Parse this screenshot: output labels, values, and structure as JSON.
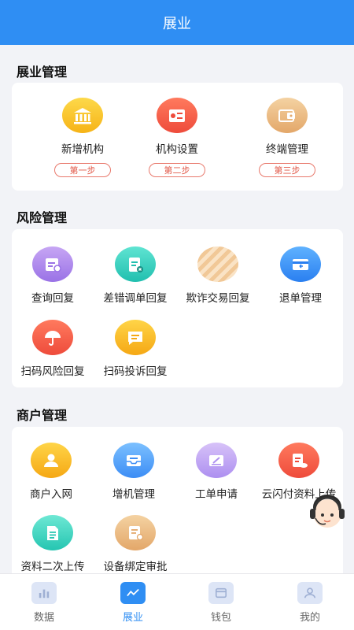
{
  "header": {
    "title": "展业"
  },
  "sections": [
    {
      "title": "展业管理",
      "items": [
        {
          "label": "新增机构",
          "step": "第一步",
          "icon": "bank-icon"
        },
        {
          "label": "机构设置",
          "step": "第二步",
          "icon": "settings-list-icon"
        },
        {
          "label": "终端管理",
          "step": "第三步",
          "icon": "pos-terminal-icon"
        }
      ]
    },
    {
      "title": "风险管理",
      "items": [
        {
          "label": "查询回复",
          "icon": "calendar-search-icon"
        },
        {
          "label": "差错调单回复",
          "icon": "document-error-icon"
        },
        {
          "label": "欺诈交易回复",
          "icon": "striped-ball-icon"
        },
        {
          "label": "退单管理",
          "icon": "card-return-icon"
        },
        {
          "label": "扫码风险回复",
          "icon": "umbrella-icon"
        },
        {
          "label": "扫码投诉回复",
          "icon": "message-icon"
        }
      ]
    },
    {
      "title": "商户管理",
      "items": [
        {
          "label": "商户入网",
          "icon": "merchant-user-icon"
        },
        {
          "label": "增机管理",
          "icon": "tray-icon"
        },
        {
          "label": "工单申请",
          "icon": "edit-form-icon"
        },
        {
          "label": "云闪付资料上传",
          "icon": "document-cloud-icon"
        },
        {
          "label": "资料二次上传",
          "icon": "document-lines-icon"
        },
        {
          "label": "设备绑定审批",
          "icon": "approval-doc-icon"
        }
      ]
    }
  ],
  "tabbar": {
    "items": [
      {
        "label": "数据",
        "icon": "bar-chart-icon",
        "active": false
      },
      {
        "label": "展业",
        "icon": "trend-line-icon",
        "active": true
      },
      {
        "label": "钱包",
        "icon": "wallet-icon",
        "active": false
      },
      {
        "label": "我的",
        "icon": "profile-icon",
        "active": false
      }
    ]
  },
  "colors": {
    "primary": "#2f8ef3",
    "step_red": "#e25b4b",
    "background": "#f2f3f7"
  }
}
